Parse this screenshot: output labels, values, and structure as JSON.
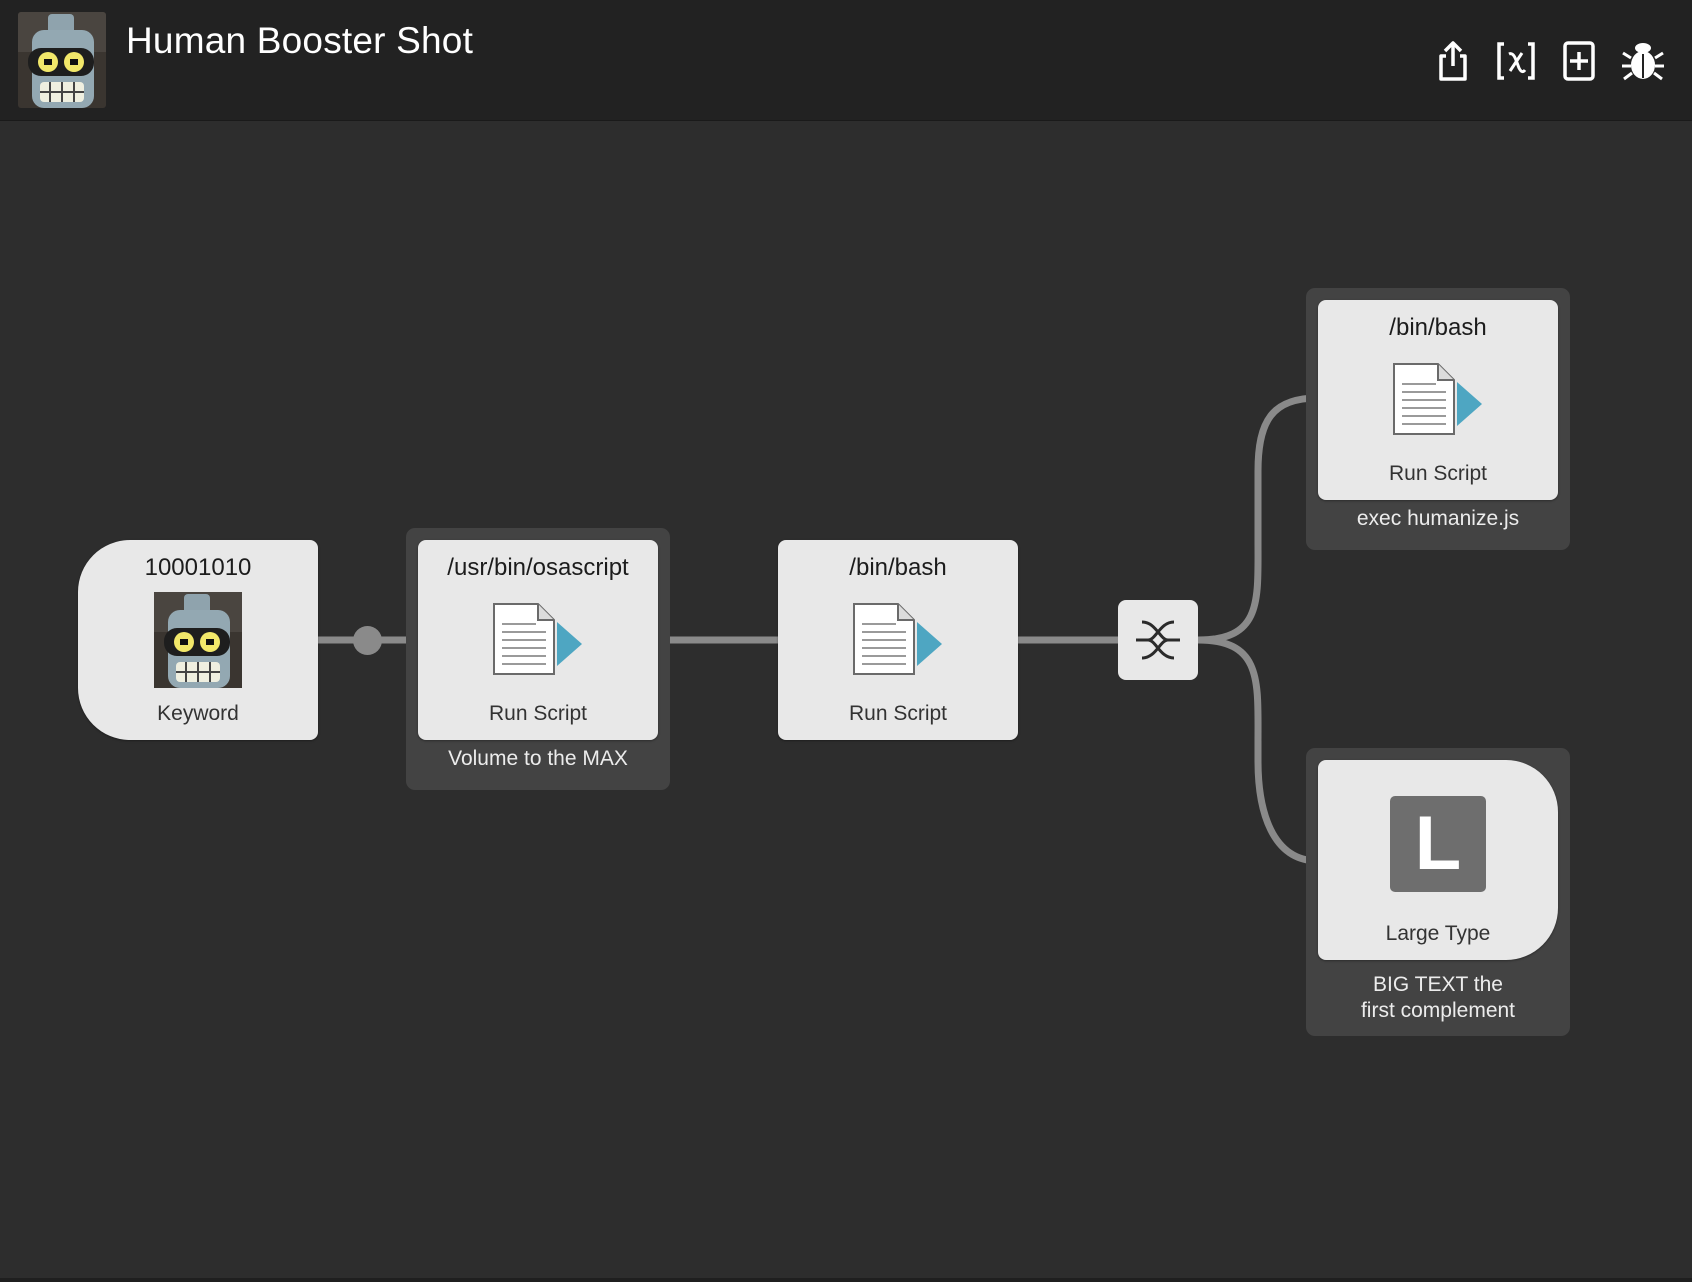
{
  "header": {
    "title": "Human Booster Shot",
    "buttons": [
      {
        "name": "share-icon"
      },
      {
        "name": "variables-icon"
      },
      {
        "name": "add-icon"
      },
      {
        "name": "debug-icon"
      }
    ]
  },
  "nodes": {
    "keyword": {
      "top": "10001010",
      "bottom": "Keyword"
    },
    "script1": {
      "top": "/usr/bin/osascript",
      "bottom": "Run Script",
      "caption": "Volume to the MAX"
    },
    "script2": {
      "top": "/bin/bash",
      "bottom": "Run Script"
    },
    "script3": {
      "top": "/bin/bash",
      "bottom": "Run Script",
      "caption": "exec humanize.js"
    },
    "largetype": {
      "letter": "L",
      "bottom": "Large Type",
      "caption_line1": "BIG TEXT the",
      "caption_line2": "first complement"
    }
  },
  "colors": {
    "background": "#2d2d2d",
    "header": "#222222",
    "node": "#e8e8e8",
    "wire": "#8a8a8a",
    "play_arrow": "#4ea6c2"
  }
}
